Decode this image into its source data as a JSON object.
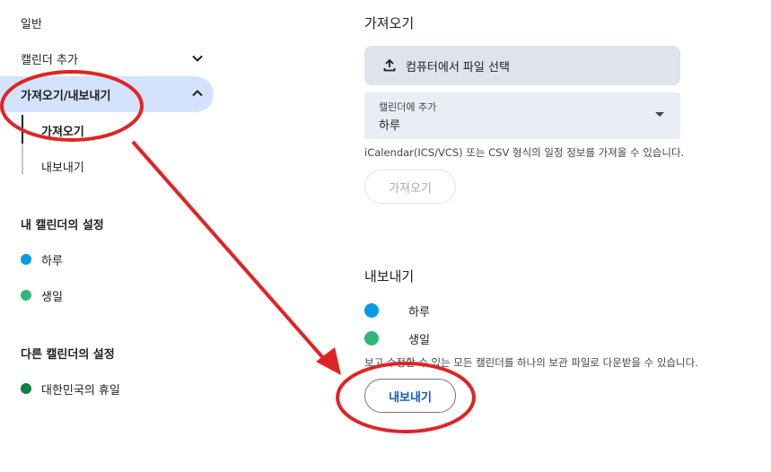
{
  "sidebar": {
    "general": "일반",
    "add_calendar": "캘린더 추가",
    "import_export": "가져오기/내보내기",
    "sub_import": "가져오기",
    "sub_export": "내보내기",
    "my_calendars_heading": "내 캘린더의 설정",
    "my_calendars": [
      {
        "label": "하루",
        "color": "#039be5"
      },
      {
        "label": "생일",
        "color": "#33b679"
      }
    ],
    "other_calendars_heading": "다른 캘린더의 설정",
    "other_calendars": [
      {
        "label": "대한민국의 휴일",
        "color": "#0b8043"
      }
    ]
  },
  "import": {
    "title": "가져오기",
    "file_button": "컴퓨터에서 파일 선택",
    "select_label": "캘린더에 추가",
    "select_value": "하루",
    "helper": "iCalendar(ICS/VCS) 또는 CSV 형식의 일정 정보를 가져올 수 있습니다.",
    "button": "가져오기"
  },
  "export": {
    "title": "내보내기",
    "calendars": [
      {
        "label": "하루",
        "color": "#039be5"
      },
      {
        "label": "생일",
        "color": "#33b679"
      }
    ],
    "helper": "보고 수정할 수 있는 모든 캘린더를 하나의 보관 파일로 다운받을 수 있습니다.",
    "button": "내보내기"
  },
  "annotation": {
    "color": "#e02424"
  }
}
